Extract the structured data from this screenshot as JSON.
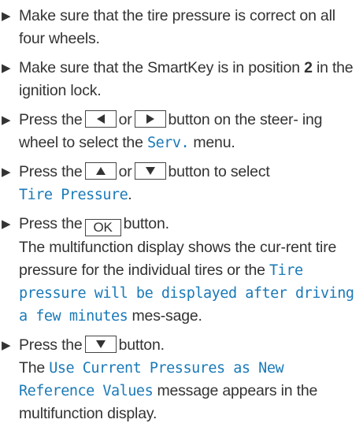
{
  "steps": [
    {
      "t1": "Make sure that the tire pressure is correct on all four wheels."
    },
    {
      "t1": "Make sure that the SmartKey is in position",
      "bold": "2",
      "t2": "in the ignition lock."
    },
    {
      "t1": "Press the",
      "or": "or",
      "t2": "button on the steer-",
      "t3": "ing wheel to select the",
      "menu": "Serv.",
      "t4": "menu."
    },
    {
      "t1": "Press the",
      "or": "or",
      "t2": "button to select",
      "menu": "Tire Pressure",
      "t3": "."
    },
    {
      "t1": "Press the",
      "ok_label": "OK",
      "t2": "button.",
      "t3": "The multifunction display shows the cur-rent tire pressure for the individual tires or the",
      "msg": "Tire pressure will be displayed after driving a few minutes",
      "t4": "mes-sage."
    },
    {
      "t1": "Press the",
      "t2": "button.",
      "t3": "The",
      "msg": "Use Current Pressures as New Reference Values",
      "t4": "message appears in the multifunction display."
    }
  ],
  "icons": {
    "bullet": "right-triangle-bullet",
    "left": "left-arrow-icon",
    "right": "right-arrow-icon",
    "up": "up-arrow-icon",
    "down": "down-arrow-icon"
  }
}
